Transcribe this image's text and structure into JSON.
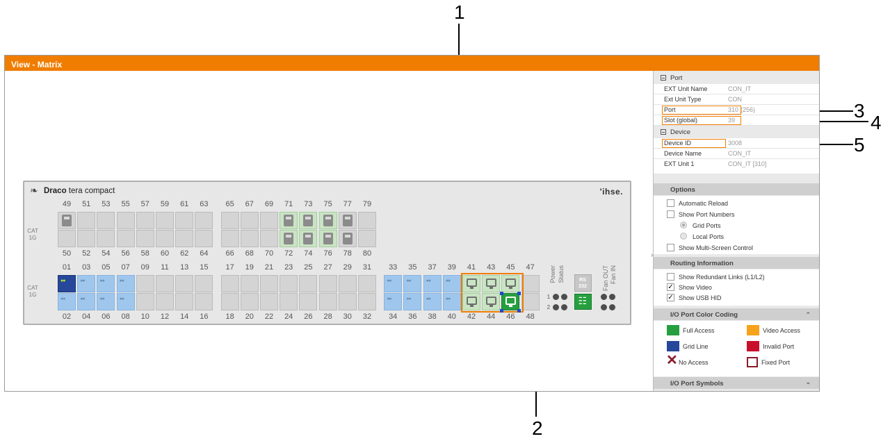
{
  "callouts": [
    "1",
    "2",
    "3",
    "4",
    "5"
  ],
  "window": {
    "title": "View - Matrix"
  },
  "device": {
    "brand_bold": "Draco",
    "brand_rest": " tera compact",
    "logo": "'ihse.",
    "cat_label": [
      "CAT",
      "1G"
    ],
    "top_numbers_upper": [
      "49",
      "51",
      "53",
      "55",
      "57",
      "59",
      "61",
      "63",
      "65",
      "67",
      "69",
      "71",
      "73",
      "75",
      "77",
      "79"
    ],
    "top_numbers_lower": [
      "50",
      "52",
      "54",
      "56",
      "58",
      "60",
      "62",
      "64",
      "66",
      "68",
      "70",
      "72",
      "74",
      "76",
      "78",
      "80"
    ],
    "bottom_numbers_upper": [
      "01",
      "03",
      "05",
      "07",
      "09",
      "11",
      "13",
      "15",
      "17",
      "19",
      "21",
      "23",
      "25",
      "27",
      "29",
      "31",
      "33",
      "35",
      "37",
      "39",
      "41",
      "43",
      "45",
      "47"
    ],
    "bottom_numbers_lower": [
      "02",
      "04",
      "06",
      "08",
      "10",
      "12",
      "14",
      "16",
      "18",
      "20",
      "22",
      "24",
      "26",
      "28",
      "30",
      "32",
      "34",
      "36",
      "38",
      "40",
      "42",
      "44",
      "46",
      "48"
    ],
    "power_label": "Power",
    "status_label": "Status",
    "fan_out_label": "Fan OUT",
    "fan_in_label": "Fan IN",
    "rs232_label": [
      "RS",
      "232"
    ],
    "led_rows": [
      "1",
      "2"
    ]
  },
  "properties": {
    "port_section": "Port",
    "port_rows": [
      {
        "key": "EXT Unit Name",
        "value": "CON_IT"
      },
      {
        "key": "Ext Unit Type",
        "value": "CON"
      },
      {
        "key": "Port",
        "value": "310",
        "extra": "(256)"
      },
      {
        "key": "Slot (global)",
        "value": "39"
      }
    ],
    "device_section": "Device",
    "device_rows": [
      {
        "key": "Device ID",
        "value": "3008"
      },
      {
        "key": "Device Name",
        "value": "CON_IT"
      },
      {
        "key": "EXT Unit 1",
        "value": "CON_IT [310]"
      }
    ]
  },
  "options": {
    "title": "Options",
    "automatic_reload": "Automatic Reload",
    "show_port_numbers": "Show Port Numbers",
    "grid_ports": "Grid Ports",
    "local_ports": "Local Ports",
    "show_multiscreen": "Show Multi-Screen Control"
  },
  "routing": {
    "title": "Routing Information",
    "redundant": "Show Redundant Links (L1/L2)",
    "video": "Show Video",
    "usb": "Show USB HID",
    "check_mark": "✓"
  },
  "color_coding": {
    "title": "I/O Port Color Coding",
    "full_access": "Full Access",
    "video_access": "Video Access",
    "grid_line": "Grid Line",
    "invalid_port": "Invalid Port",
    "no_access": "No Access",
    "fixed_port": "Fixed Port",
    "colors": {
      "full": "#26a03f",
      "video": "#f7a21b",
      "grid": "#27479a",
      "invalid": "#c8102e",
      "no_access": "#8b1a2b",
      "fixed": "#8b1a2b"
    }
  },
  "symbols": {
    "title": "I/O Port Symbols"
  },
  "icons": {
    "collapse": "chevron-right-icon",
    "expand_up": "chevron-up-icon",
    "expand_down": "chevron-down-icon",
    "dragon": "dragon-logo-icon"
  }
}
